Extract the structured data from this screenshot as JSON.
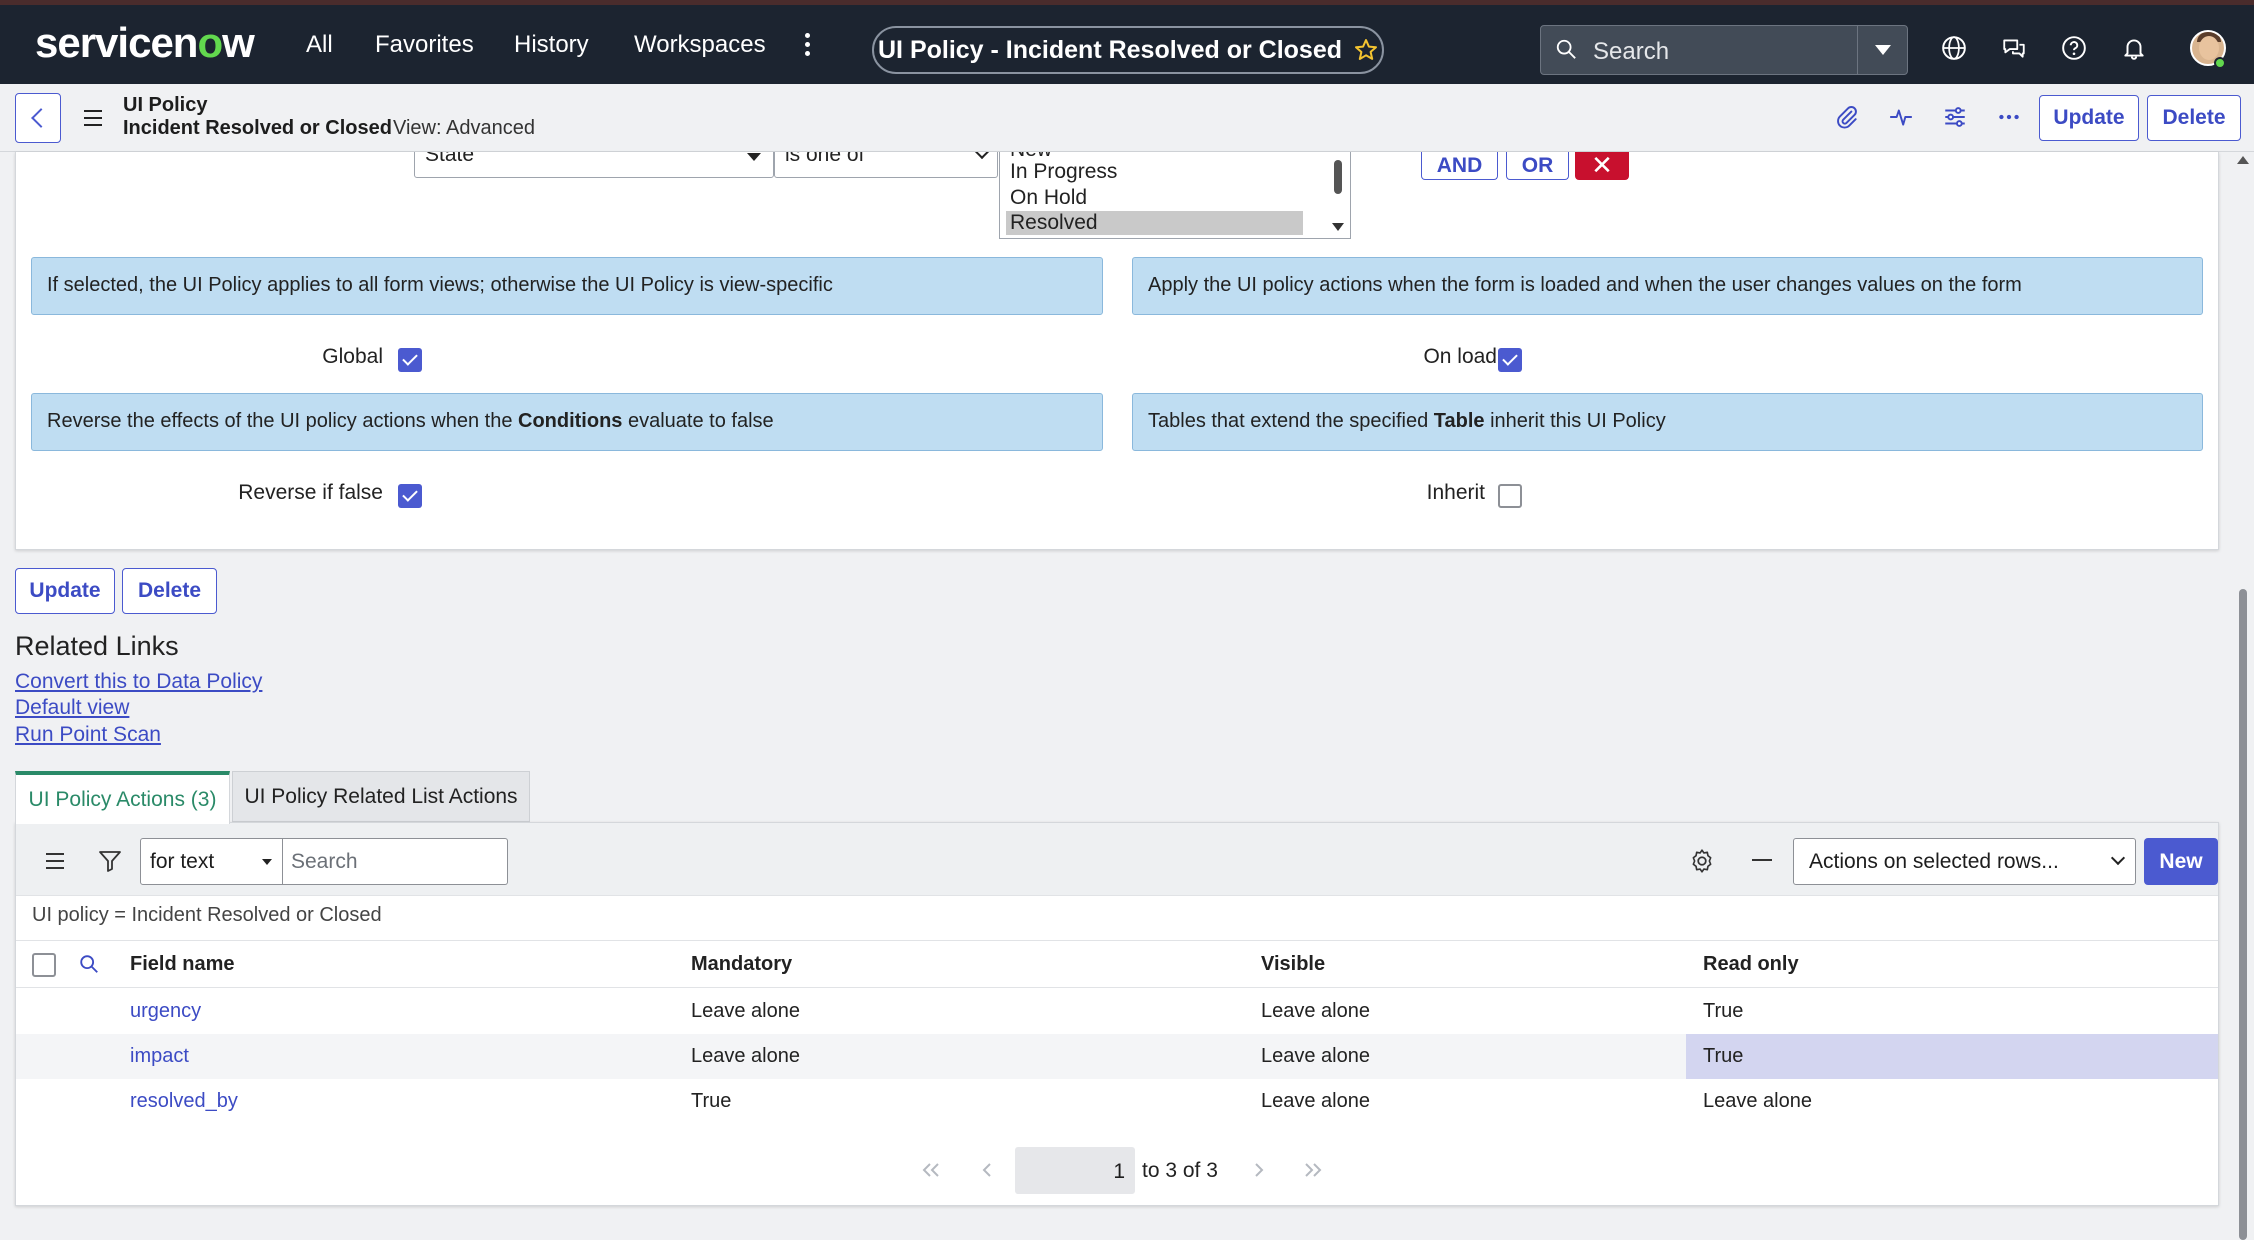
{
  "topnav": {
    "logo_prefix": "servicen",
    "logo_o": "o",
    "logo_suffix": "w",
    "items": [
      "All",
      "Favorites",
      "History",
      "Workspaces"
    ],
    "record_title": "UI Policy - Incident Resolved or Closed",
    "search_placeholder": "Search",
    "icons": [
      "globe-icon",
      "chat-icon",
      "help-icon",
      "bell-icon",
      "avatar"
    ]
  },
  "form_header": {
    "table_label": "UI Policy",
    "record_name": "Incident Resolved or Closed",
    "view_label": "View: Advanced",
    "icons": [
      "paperclip-icon",
      "activity-icon",
      "settings-sliders-icon",
      "more-icon"
    ],
    "update_label": "Update",
    "delete_label": "Delete"
  },
  "condition": {
    "field": "State",
    "operator": "is one of",
    "options": [
      "New",
      "In Progress",
      "On Hold",
      "Resolved"
    ],
    "selected": "Resolved",
    "and_label": "AND",
    "or_label": "OR",
    "remove_label": "✕"
  },
  "fields": {
    "global_help": "If selected, the UI Policy applies to all form views; otherwise the UI Policy is view-specific",
    "onload_help": "Apply the UI policy actions when the form is loaded and when the user changes values on the form",
    "reverse_help_pre": "Reverse the effects of the UI policy actions when the ",
    "reverse_help_bold": "Conditions",
    "reverse_help_post": " evaluate to false",
    "inherit_help_pre": "Tables that extend the specified ",
    "inherit_help_bold": "Table",
    "inherit_help_post": " inherit this UI Policy",
    "global_label": "Global",
    "global_checked": true,
    "onload_label": "On load",
    "onload_checked": true,
    "reverse_label": "Reverse if false",
    "reverse_checked": true,
    "inherit_label": "Inherit",
    "inherit_checked": false
  },
  "form_footer": {
    "update_label": "Update",
    "delete_label": "Delete"
  },
  "related_links": {
    "title": "Related Links",
    "links": [
      "Convert this to Data Policy",
      "Default view",
      "Run Point Scan"
    ]
  },
  "tabs": {
    "active": "UI Policy Actions (3)",
    "inactive": "UI Policy Related List Actions"
  },
  "list": {
    "search_field": "for text",
    "search_placeholder": "Search",
    "actions_select": "Actions on selected rows...",
    "new_label": "New",
    "breadcrumb": "UI policy = Incident Resolved or Closed",
    "columns": [
      "Field name",
      "Mandatory",
      "Visible",
      "Read only"
    ],
    "rows": [
      [
        "urgency",
        "Leave alone",
        "Leave alone",
        "True"
      ],
      [
        "impact",
        "Leave alone",
        "Leave alone",
        "True"
      ],
      [
        "resolved_by",
        "True",
        "Leave alone",
        "Leave alone"
      ]
    ],
    "pager_page": "1",
    "pager_text": "to 3 of 3"
  },
  "colors": {
    "accent": "#4b5ad0",
    "tab_active": "#2a8a68",
    "info_bg": "#bfddf2",
    "remove_red": "#c8102e",
    "nav_bg": "#1c2430"
  }
}
